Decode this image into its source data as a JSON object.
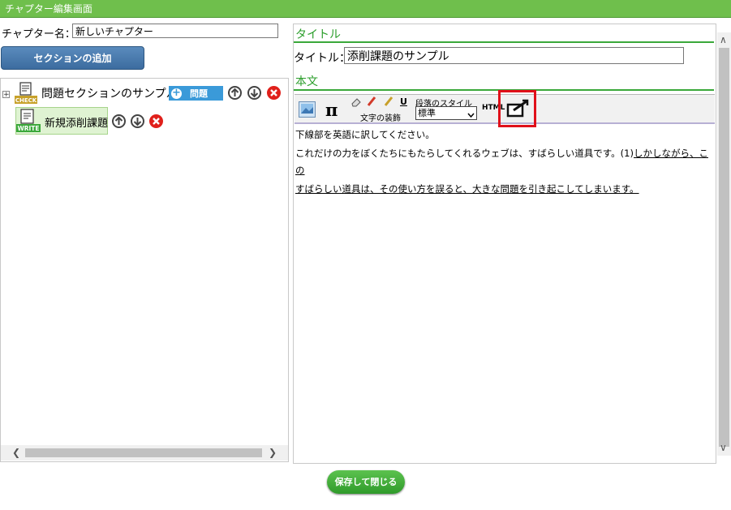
{
  "window": {
    "title": "チャプター編集画面"
  },
  "chapter": {
    "name_label": "チャプター名：",
    "name_value": "新しいチャプター"
  },
  "buttons": {
    "add_section": "セクションの追加",
    "save_close": "保存して閉じる"
  },
  "tree": {
    "expander": "+",
    "section": {
      "label": "問題セクションのサンプル",
      "icon_text": "CHECK",
      "add_problem_label": "問題"
    },
    "item": {
      "label": "新規添削課題",
      "icon_text": "WRITE"
    }
  },
  "editor": {
    "title_heading": "タイトル",
    "title_label": "タイトル：",
    "title_value": "添削課題のサンプル",
    "body_heading": "本文",
    "toolbar": {
      "pi_symbol": "π",
      "text_decoration_label": "文字の装飾",
      "underline_glyph": "U",
      "paragraph_style_label": "段落のスタイル",
      "style_value": "標準",
      "html_label": "HTML"
    },
    "content": {
      "line1": "下線部を英語に訳してください。",
      "line2_plain": "これだけの力をぼくたちにもたらしてくれるウェブは、すばらしい道具です。(1)",
      "line2_underlined": "しかしながら、この",
      "line3_underlined": "すばらしい道具は、その使い方を誤ると、大きな問題を引き起こしてしまいます。"
    }
  },
  "colors": {
    "header_green": "#6fbf4c",
    "accent_green": "#2a9d2a",
    "button_blue": "#3c6c9f",
    "highlight_red": "#e0101a",
    "delete_red": "#e0201b"
  }
}
